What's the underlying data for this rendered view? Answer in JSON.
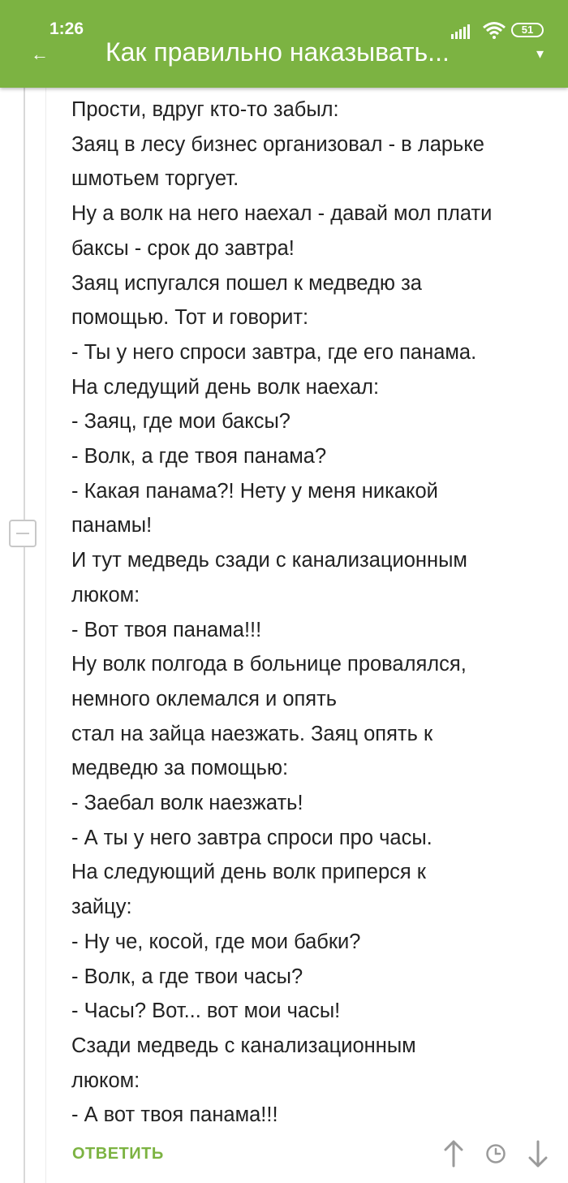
{
  "status_bar": {
    "time": "1:26",
    "battery": "51",
    "icons": [
      "signal-icon",
      "wifi-icon",
      "battery-icon"
    ]
  },
  "app_bar": {
    "title": "Как правильно наказывать...",
    "icons": [
      "back-arrow-icon",
      "dropdown-icon"
    ],
    "background": "#7cb342"
  },
  "comment": {
    "lines": [
      "Прости, вдруг кто-то забыл:",
      "Заяц в лесу бизнес организовал - в ларьке",
      "шмотьем торгует.",
      "Ну а волк на него наехал - давай мол плати",
      "баксы - срок до завтра!",
      "Заяц испугался пошел к медведю за",
      "помощью. Тот и говорит:",
      "- Ты у него спроси завтра, где его панама.",
      "На следущий день волк наехал:",
      "- Заяц, где мои баксы?",
      "- Волк, а где твоя панама?",
      "- Какая панама?! Нету у меня никакой",
      "панамы!",
      "И тут медведь сзади с канализационным",
      "люком:",
      "- Вот твоя панама!!!",
      "Ну волк полгода в больнице провалялся,",
      "немного оклемался и опять",
      "стал на зайца наезжать. Заяц опять к",
      "медведю за помощью:",
      "- Заебал волк наезжать!",
      "- А ты у него завтра спроси про часы.",
      "На следующий день волк приперся к",
      "зайцу:",
      "- Ну че, косой, где мои бабки?",
      "- Волк, а где твои часы?",
      "- Часы? Вот... вот мои часы!",
      "Сзади медведь с канализационным",
      "люком:",
      "- А вот твоя панама!!!"
    ]
  },
  "actions": {
    "reply_label": "ОТВЕТИТЬ",
    "icons": [
      "arrow-up-icon",
      "clock-icon",
      "arrow-down-icon"
    ],
    "accent": "#7cb342"
  }
}
